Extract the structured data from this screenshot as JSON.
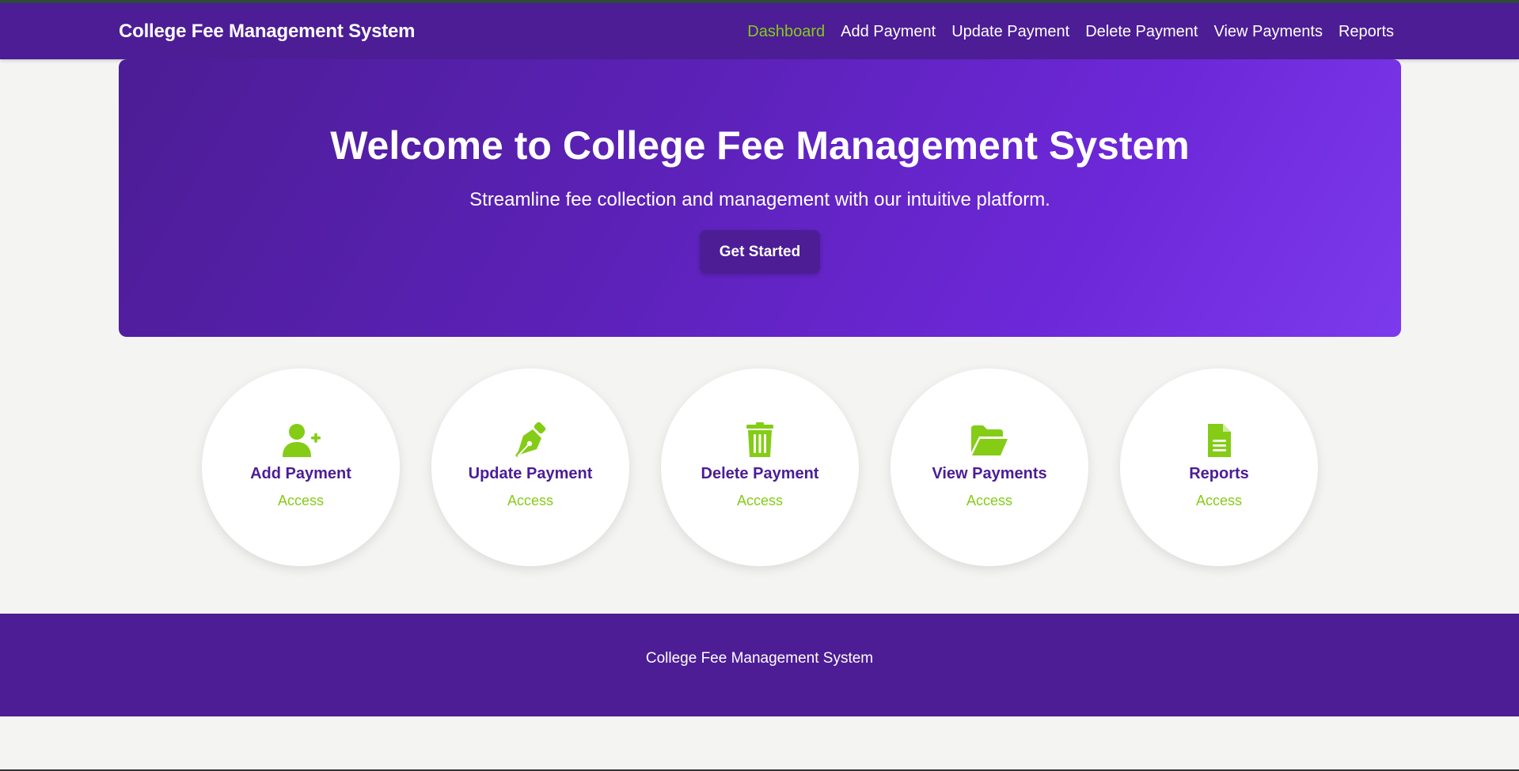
{
  "colors": {
    "primary": "#4c1d95",
    "accent": "#84cc16",
    "background": "#f4f4f2"
  },
  "navbar": {
    "brand": "College Fee Management System",
    "links": [
      {
        "label": "Dashboard",
        "active": true
      },
      {
        "label": "Add Payment",
        "active": false
      },
      {
        "label": "Update Payment",
        "active": false
      },
      {
        "label": "Delete Payment",
        "active": false
      },
      {
        "label": "View Payments",
        "active": false
      },
      {
        "label": "Reports",
        "active": false
      }
    ]
  },
  "hero": {
    "title": "Welcome to College Fee Management System",
    "subtitle": "Streamline fee collection and management with our intuitive platform.",
    "button_label": "Get Started"
  },
  "cards": [
    {
      "icon": "user-plus-icon",
      "title": "Add Payment",
      "link": "Access"
    },
    {
      "icon": "pen-nib-icon",
      "title": "Update Payment",
      "link": "Access"
    },
    {
      "icon": "trash-icon",
      "title": "Delete Payment",
      "link": "Access"
    },
    {
      "icon": "folder-open-icon",
      "title": "View Payments",
      "link": "Access"
    },
    {
      "icon": "file-lines-icon",
      "title": "Reports",
      "link": "Access"
    }
  ],
  "footer": {
    "text": "College Fee Management System"
  }
}
